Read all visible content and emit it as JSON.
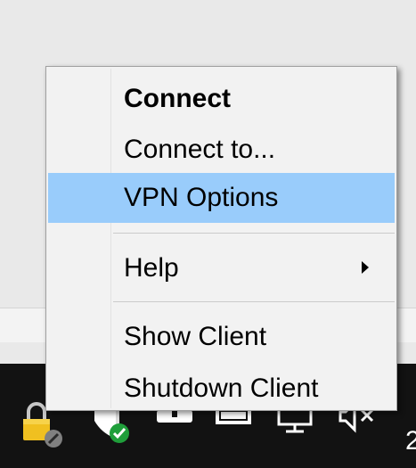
{
  "context_menu": {
    "items": [
      {
        "label": "Connect",
        "bold": true
      },
      {
        "label": "Connect to..."
      },
      {
        "label": "VPN Options",
        "highlighted": true
      },
      {
        "label": "Help",
        "submenu": true
      },
      {
        "label": "Show Client"
      },
      {
        "label": "Shutdown Client"
      }
    ]
  },
  "tray": {
    "icons": [
      "lock-disconnected-icon",
      "shield-check-icon",
      "upload-drive-icon",
      "battery-icon",
      "network-monitor-icon",
      "speaker-muted-icon"
    ],
    "clock_partial": "2"
  },
  "colors": {
    "highlight": "#99ccfb",
    "menu_bg": "#f2f2f2",
    "taskbar": "#121212"
  }
}
